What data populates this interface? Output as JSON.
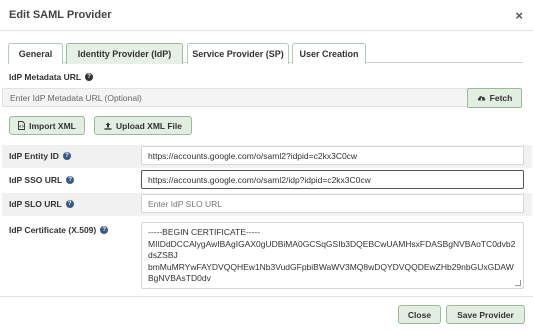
{
  "dialog": {
    "title": "Edit SAML Provider",
    "close_glyph": "×"
  },
  "tabs": [
    {
      "label": "General",
      "active": false
    },
    {
      "label": "Identity Provider (IdP)",
      "active": true
    },
    {
      "label": "Service Provider (SP)",
      "active": false
    },
    {
      "label": "User Creation",
      "active": false
    }
  ],
  "metadata": {
    "label": "IdP Metadata URL",
    "placeholder": "Enter IdP Metadata URL (Optional)",
    "fetch_label": "Fetch",
    "fetch_icon": "cloud-download-icon"
  },
  "import": {
    "import_xml_label": "Import XML",
    "import_xml_icon": "file-code-icon",
    "upload_label": "Upload XML File",
    "upload_icon": "upload-icon"
  },
  "fields": {
    "entity_id": {
      "label": "IdP Entity ID",
      "value": "https://accounts.google.com/o/saml2?idpid=c2kx3C0cw"
    },
    "sso_url": {
      "label": "IdP SSO URL",
      "value": "https://accounts.google.com/o/saml2/idp?idpid=c2kx3C0cw"
    },
    "slo_url": {
      "label": "IdP SLO URL",
      "placeholder": "Enter IdP SLO URL"
    },
    "certificate": {
      "label": "IdP Certificate (X.509)",
      "lines": [
        "-----BEGIN CERTIFICATE-----",
        "MIIDdDCCAlygAwIBAgIGAX0gUDBiMA0GCSqGSIb3DQEBCwUAMHsxFDASBgNVBAoTC0dvb2dsZSBJ",
        "bmMuMRYwFAYDVQQHEw1Nb3VudGFpbiBWaWV3MQ8wDQYDVQQDEwZHb29nbGUxGDAWBgNVBAsTD0dv"
      ]
    }
  },
  "footer": {
    "close_label": "Close",
    "save_label": "Save Provider"
  },
  "colors": {
    "accent_bg": "#e3eee3",
    "accent_border": "#9db99d"
  }
}
